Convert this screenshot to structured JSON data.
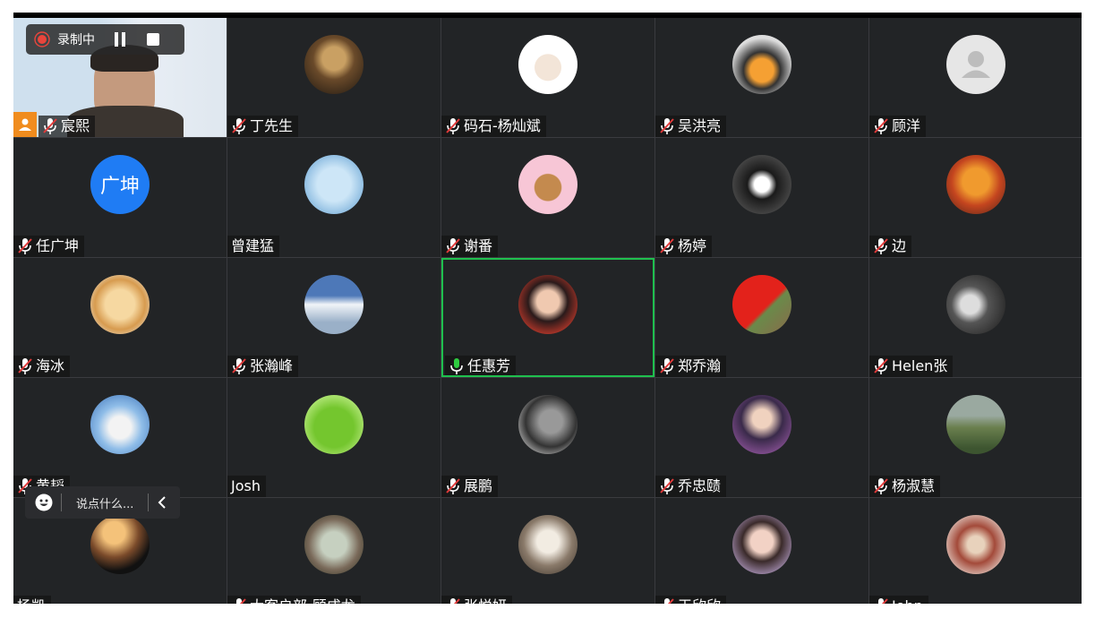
{
  "recording": {
    "label": "录制中"
  },
  "chat": {
    "placeholder": "说点什么..."
  },
  "colors": {
    "speaking_border": "#1fc04e",
    "tile_bg": "#222426",
    "mic_muted": "#ffffff",
    "mic_active": "#2ecc40"
  },
  "participants": [
    {
      "name": "宸熙",
      "mic": "muted",
      "avatar": "video"
    },
    {
      "name": "丁先生",
      "mic": "muted",
      "avatar": "photo-woman-sepia"
    },
    {
      "name": "码石-杨灿斌",
      "mic": "muted",
      "avatar": "cartoon-man"
    },
    {
      "name": "吴洪亮",
      "mic": "muted",
      "avatar": "photo-orb"
    },
    {
      "name": "顾洋",
      "mic": "muted",
      "avatar": "default-person"
    },
    {
      "name": "任广坤",
      "mic": "muted",
      "avatar": "text",
      "avatar_text": "广坤",
      "avatar_color": "#1f7cf4"
    },
    {
      "name": "曾建猛",
      "mic": "none",
      "avatar": "photo-hands"
    },
    {
      "name": "谢番",
      "mic": "muted",
      "avatar": "cartoon-bear"
    },
    {
      "name": "杨婷",
      "mic": "muted",
      "avatar": "photo-kuromi"
    },
    {
      "name": "边",
      "mic": "muted",
      "avatar": "photo-autumn-tree"
    },
    {
      "name": "海冰",
      "mic": "muted",
      "avatar": "photo-doge"
    },
    {
      "name": "张瀚峰",
      "mic": "muted",
      "avatar": "photo-clouds"
    },
    {
      "name": "任惠芳",
      "mic": "active",
      "avatar": "photo-woman",
      "speaking": true
    },
    {
      "name": "郑乔瀚",
      "mic": "muted",
      "avatar": "photo-flag"
    },
    {
      "name": "Helen张",
      "mic": "muted",
      "avatar": "photo-dark-portrait"
    },
    {
      "name": "黄韬",
      "mic": "muted",
      "avatar": "photo-tree-cat"
    },
    {
      "name": "Josh",
      "mic": "none",
      "avatar": "cartoon-frog"
    },
    {
      "name": "展鹏",
      "mic": "muted",
      "avatar": "photo-man-bw"
    },
    {
      "name": "乔忠赜",
      "mic": "muted",
      "avatar": "photo-man-purple"
    },
    {
      "name": "杨淑慧",
      "mic": "muted",
      "avatar": "photo-landscape"
    },
    {
      "name": "杨凯",
      "mic": "none",
      "avatar": "photo-silhouette-sunset"
    },
    {
      "name": "大客户部-顾成龙",
      "mic": "muted",
      "avatar": "photo-arch"
    },
    {
      "name": "张悦妍",
      "mic": "muted",
      "avatar": "photo-dog"
    },
    {
      "name": "王欣欣",
      "mic": "muted",
      "avatar": "photo-woman-selfie"
    },
    {
      "name": "John",
      "mic": "muted",
      "avatar": "photo-tea"
    }
  ]
}
